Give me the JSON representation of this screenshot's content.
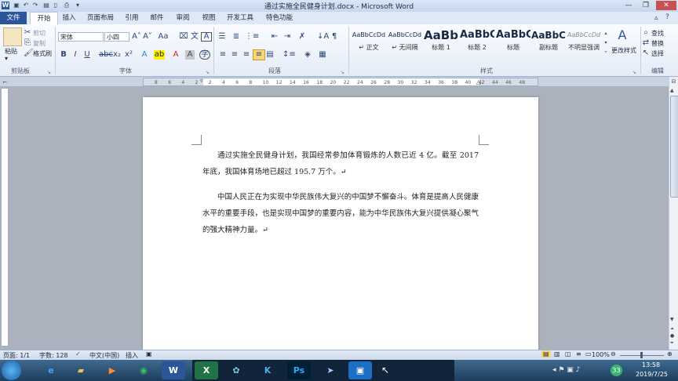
{
  "window": {
    "title": "通过实施全民健身计划.docx - Microsoft Word"
  },
  "tabs": [
    "文件",
    "开始",
    "插入",
    "页面布局",
    "引用",
    "邮件",
    "审阅",
    "视图",
    "开发工具",
    "特色功能"
  ],
  "clipboard": {
    "paste": "粘贴",
    "cut": "剪切",
    "copy": "复制",
    "format_painter": "格式刷",
    "group": "剪贴板"
  },
  "font": {
    "name": "宋体",
    "size": "小四",
    "group": "字体"
  },
  "paragraph": {
    "group": "段落"
  },
  "styles": {
    "group": "样式",
    "items": [
      {
        "sample": "AaBbCcDd",
        "name": "↵ 正文"
      },
      {
        "sample": "AaBbCcDd",
        "name": "↵ 无间隔"
      },
      {
        "sample": "AaBb",
        "name": "标题 1"
      },
      {
        "sample": "AaBbC",
        "name": "标题 2"
      },
      {
        "sample": "AaBbC",
        "name": "标题"
      },
      {
        "sample": "AaBbC",
        "name": "副标题"
      },
      {
        "sample": "AaBbCcDd",
        "name": "不明显强调"
      }
    ],
    "change": "更改样式"
  },
  "editing": {
    "group": "编辑",
    "find": "查找",
    "replace": "替换",
    "select": "选择"
  },
  "ruler_marks": [
    "8",
    "6",
    "4",
    "2",
    "2",
    "4",
    "6",
    "8",
    "10",
    "12",
    "14",
    "16",
    "18",
    "20",
    "22",
    "24",
    "26",
    "28",
    "30",
    "32",
    "34",
    "36",
    "38",
    "40",
    "42",
    "44",
    "46",
    "48"
  ],
  "document": {
    "para1": "通过实施全民健身计划，我国经常参加体育锻炼的人数已近 4 亿。截至 2017 年底，我国体育场地已超过 195.7 万个。↵",
    "para2": "中国人民正在为实现中华民族伟大复兴的中国梦不懈奋斗。体育是提高人民健康水平的重要手段，也是实现中国梦的重要内容，能为中华民族伟大复兴提供凝心聚气的强大精神力量。↵"
  },
  "status": {
    "page": "页面: 1/1",
    "words": "字数: 128",
    "language": "中文(中国)",
    "mode": "插入",
    "zoom": "100%"
  },
  "taskbar": {
    "time": "13:58",
    "date": "2019/7/25",
    "tray_badge": "33"
  }
}
